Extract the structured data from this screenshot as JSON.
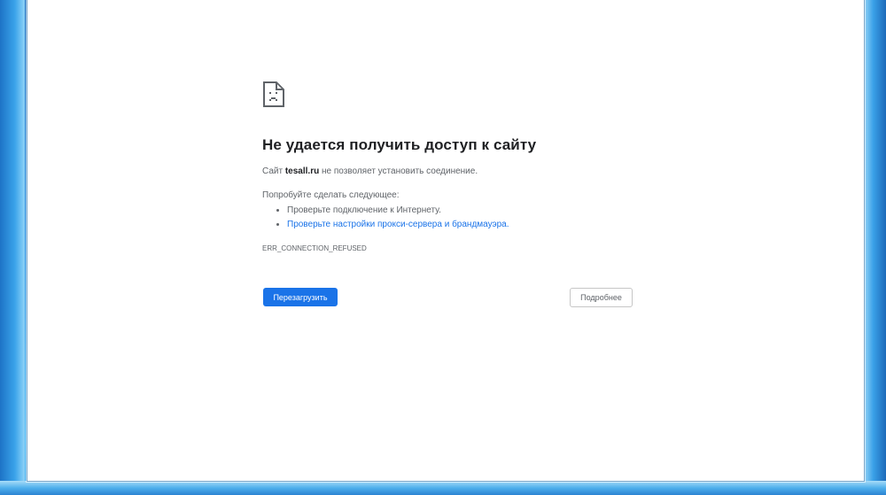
{
  "page": {
    "title": "Не удается получить доступ к сайту",
    "description": {
      "prefix": "Сайт ",
      "host": "tesall.ru",
      "suffix": " не позволяет установить соединение."
    },
    "suggestions_heading": "Попробуйте сделать следующее:",
    "suggestions": [
      {
        "text": "Проверьте подключение к Интернету."
      },
      {
        "text": "Проверьте настройки прокси-сервера и брандмауэра."
      }
    ],
    "error_code": "ERR_CONNECTION_REFUSED",
    "reload_label": "Перезагрузить",
    "details_label": "Подробнее",
    "icon": "sad-page-icon"
  },
  "colors": {
    "accent": "#1a73e8",
    "text": "#202124",
    "secondary_text": "#5f6368"
  }
}
